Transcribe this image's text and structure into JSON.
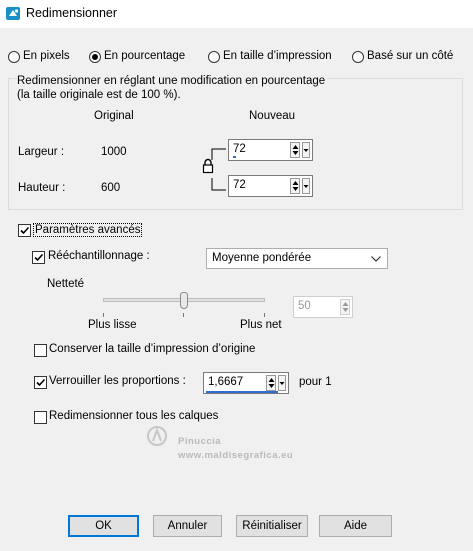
{
  "window": {
    "title": "Redimensionner"
  },
  "mode_options": {
    "pixels": "En pixels",
    "percent": "En pourcentage",
    "print_size": "En taille d’impression",
    "side": "Basé sur un côté",
    "selected": "En pourcentage"
  },
  "percent_group": {
    "description_line1": "Redimensionner en réglant une modification en pourcentage",
    "description_line2": "(la taille originale est de 100 %).",
    "col_original": "Original",
    "col_new": "Nouveau",
    "width_label": "Largeur :",
    "width_original": "1000",
    "width_new": "72",
    "height_label": "Hauteur :",
    "height_original": "600",
    "height_new": "72"
  },
  "advanced": {
    "label": "Paramètres avancés",
    "checked": true,
    "resample_label": "Rééchantillonnage :",
    "resample_checked": true,
    "resample_method": "Moyenne pondérée",
    "sharpness_label": "Netteté",
    "slider_min_label": "Plus lisse",
    "slider_max_label": "Plus net",
    "sharpness_value": "50",
    "sharpness_level": 0.5,
    "keep_print_size_label": "Conserver la taille d’impression d’origine",
    "keep_print_size_checked": false,
    "lock_ratio_label": "Verrouiller les proportions :",
    "lock_ratio_checked": true,
    "ratio_value": "1,6667",
    "ratio_suffix": "pour 1",
    "resize_all_layers_label": "Redimensionner tous les calques",
    "resize_all_layers_checked": false
  },
  "watermark": {
    "line1": "Pinuccia",
    "line2": "www.maldisegrafica.eu"
  },
  "buttons": {
    "ok": "OK",
    "cancel": "Annuler",
    "reset": "Réinitialiser",
    "help": "Aide"
  },
  "colors": {
    "accent": "#0078d7",
    "dialog_bg": "#f0f0f0",
    "lock_ratio_underline": "#2e6ec8"
  }
}
